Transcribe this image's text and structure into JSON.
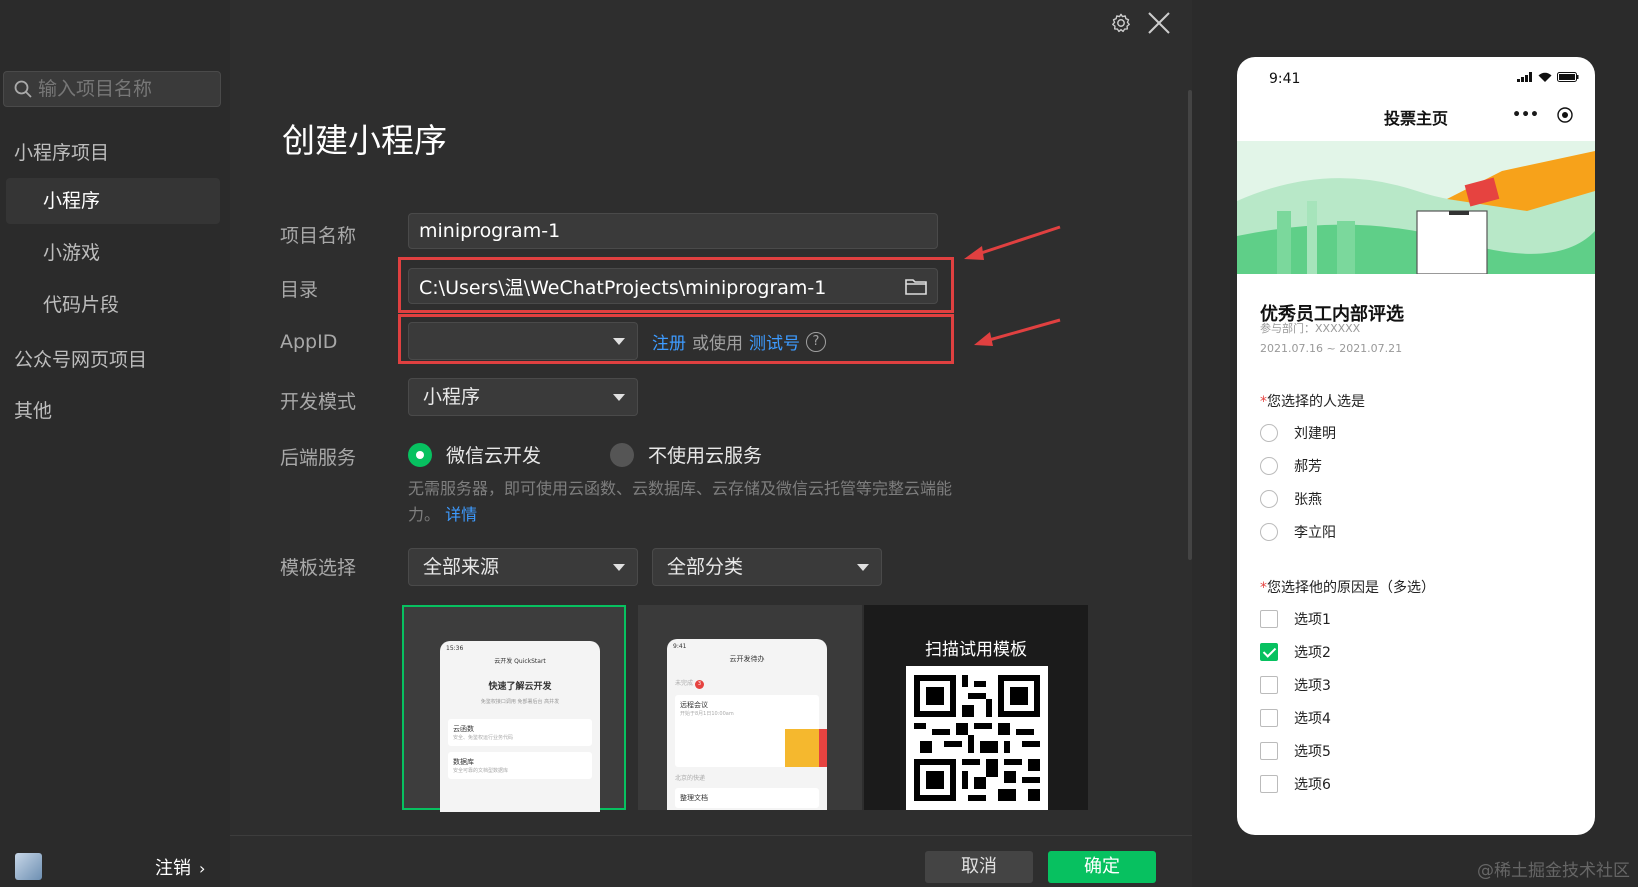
{
  "sidebar": {
    "search_placeholder": "输入项目名称",
    "groups": [
      {
        "label": "小程序项目"
      },
      {
        "label": "公众号网页项目"
      },
      {
        "label": "其他"
      }
    ],
    "items": [
      {
        "label": "小程序"
      },
      {
        "label": "小游戏"
      },
      {
        "label": "代码片段"
      }
    ],
    "logout_label": "注销",
    "logout_chevron": "›"
  },
  "main": {
    "title": "创建小程序",
    "project_name_label": "项目名称",
    "project_name_value": "miniprogram-1",
    "directory_label": "目录",
    "directory_value": "C:\\Users\\温\\WeChatProjects\\miniprogram-1",
    "appid_label": "AppID",
    "appid_value": "",
    "register_link": "注册",
    "or_use_text": "或使用",
    "test_account_link": "测试号",
    "help_glyph": "?",
    "dev_mode_label": "开发模式",
    "dev_mode_value": "小程序",
    "backend_label": "后端服务",
    "backend_options": [
      {
        "label": "微信云开发",
        "selected": true
      },
      {
        "label": "不使用云服务",
        "selected": false
      }
    ],
    "backend_desc": "无需服务器，即可使用云函数、云数据库、云存储及微信云托管等完整云端能力。",
    "details_link": "详情",
    "template_label": "模板选择",
    "source_select": "全部来源",
    "category_select": "全部分类",
    "templates": [
      {
        "time": "15:36",
        "nav": "云开发 QuickStart",
        "heading": "快速了解云开发",
        "sub": "免鉴权接口调用 免部署后台 高并发",
        "row1": "云函数",
        "row1_sub": "安全、免鉴权运行业务代码",
        "row2": "数据库",
        "row2_sub": "安全可靠的文档型数据库"
      },
      {
        "time": "9:41",
        "nav": "云开发待办",
        "tag": "未完成",
        "badge": "3",
        "item1": "远程会议",
        "item1_sub": "开始于8月1日10:00am",
        "item2": "北京的快递",
        "item3": "整理文档"
      },
      {
        "qr_title": "扫描试用模板"
      }
    ],
    "cancel_button": "取消",
    "confirm_button": "确定"
  },
  "preview": {
    "time": "9:41",
    "nav_title": "投票主页",
    "menu_glyph": "•••",
    "vote_title": "优秀员工内部评选",
    "department": "参与部门：XXXXXX",
    "date_range": "2021.07.16 ~ 2021.07.21",
    "required_mark": "*",
    "q1": "您选择的人选是",
    "q1_options": [
      "刘建明",
      "郝芳",
      "张燕",
      "李立阳"
    ],
    "q2": "您选择他的原因是（多选）",
    "q2_options": [
      {
        "label": "选项1",
        "checked": false
      },
      {
        "label": "选项2",
        "checked": true
      },
      {
        "label": "选项3",
        "checked": false
      },
      {
        "label": "选项4",
        "checked": false
      },
      {
        "label": "选项5",
        "checked": false
      },
      {
        "label": "选项6",
        "checked": false
      }
    ]
  },
  "watermark": "@稀土掘金技术社区",
  "colors": {
    "accent_green": "#07c160",
    "link_blue": "#3d9bff",
    "highlight_red": "#e04040",
    "required_red": "#e64340"
  }
}
